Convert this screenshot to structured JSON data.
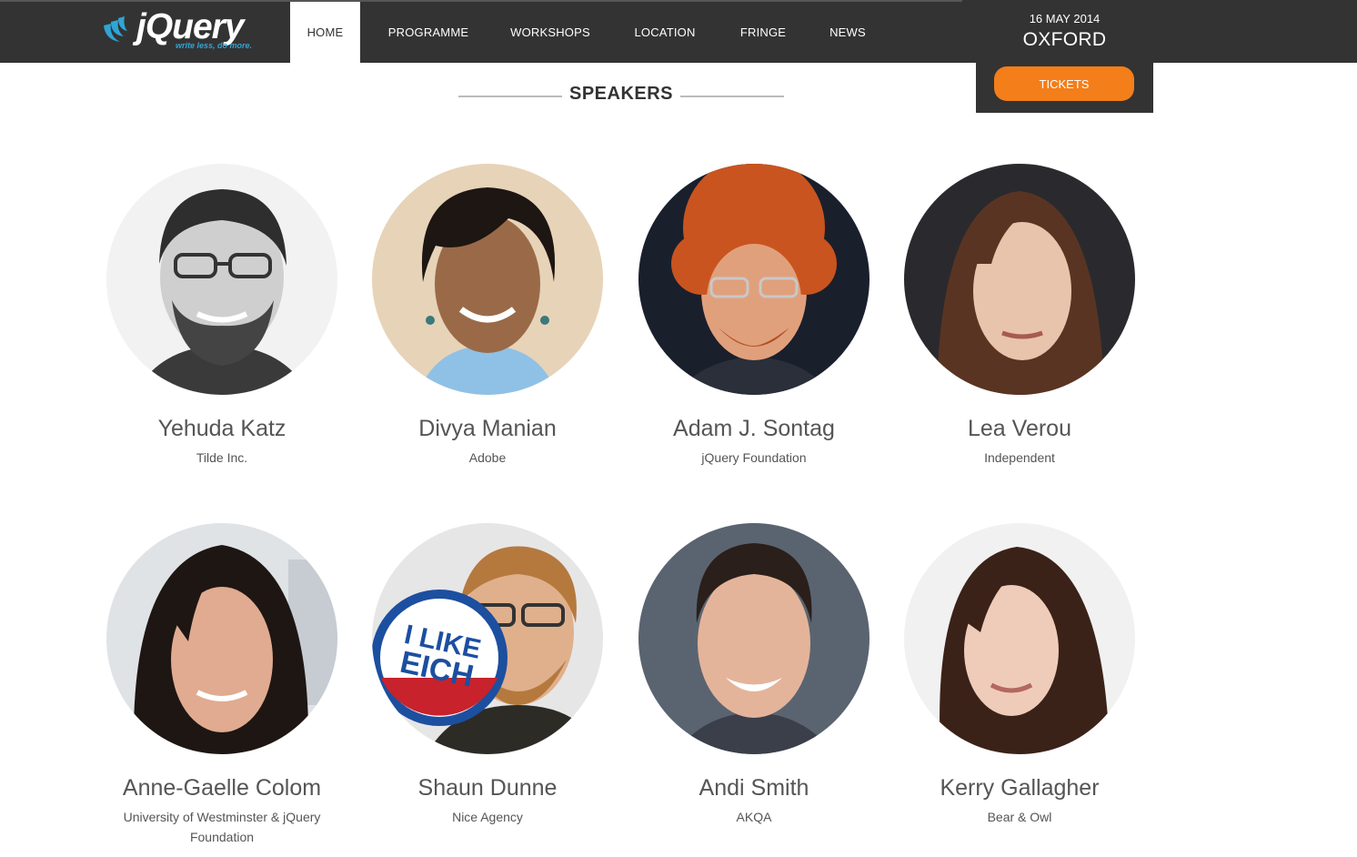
{
  "brand": {
    "logo_word": "jQuery",
    "logo_tagline": "write less, do more.",
    "accent": "#2fa5d6"
  },
  "nav": {
    "items": [
      {
        "label": "HOME",
        "active": true
      },
      {
        "label": "PROGRAMME",
        "active": false
      },
      {
        "label": "WORKSHOPS",
        "active": false
      },
      {
        "label": "LOCATION",
        "active": false
      },
      {
        "label": "FRINGE",
        "active": false
      },
      {
        "label": "NEWS",
        "active": false
      }
    ]
  },
  "event": {
    "date": "16 MAY 2014",
    "city": "OXFORD",
    "tickets_label": "TICKETS",
    "tickets_color": "#f37e1a"
  },
  "section": {
    "title": "SPEAKERS"
  },
  "speakers": [
    {
      "name": "Yehuda Katz",
      "company": "Tilde Inc."
    },
    {
      "name": "Divya Manian",
      "company": "Adobe"
    },
    {
      "name": "Adam J. Sontag",
      "company": "jQuery Foundation"
    },
    {
      "name": "Lea Verou",
      "company": "Independent"
    },
    {
      "name": "Anne-Gaelle Colom",
      "company": "University of Westminster & jQuery Foundation"
    },
    {
      "name": "Shaun Dunne",
      "company": "Nice Agency"
    },
    {
      "name": "Andi Smith",
      "company": "AKQA"
    },
    {
      "name": "Kerry Gallagher",
      "company": "Bear & Owl"
    }
  ],
  "photo_badge": {
    "line1": "I LIKE",
    "line2": "EICH"
  }
}
